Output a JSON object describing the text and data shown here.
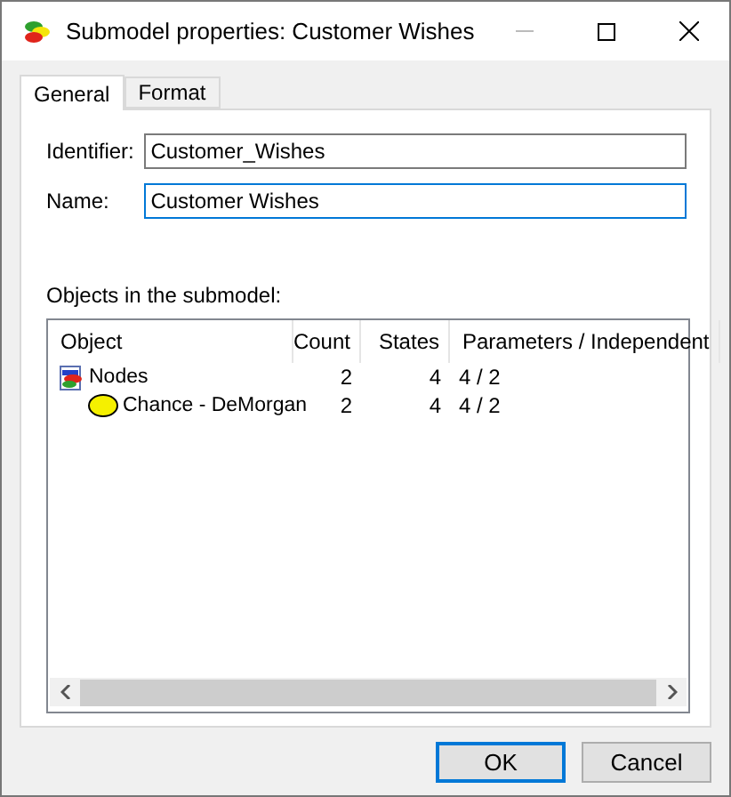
{
  "window": {
    "title": "Submodel properties: Customer Wishes"
  },
  "tabs": [
    {
      "label": "General",
      "selected": true
    },
    {
      "label": "Format",
      "selected": false
    }
  ],
  "fields": [
    {
      "label": "Identifier:",
      "value": "Customer_Wishes",
      "focused": false
    },
    {
      "label": "Name:",
      "value": "Customer Wishes",
      "focused": true
    }
  ],
  "objects": {
    "label": "Objects in the submodel:",
    "columns": [
      "Object",
      "Count",
      "States",
      "Parameters / Independent"
    ],
    "rows": [
      {
        "kind": "folder",
        "name": "Nodes",
        "count": "2",
        "states": "4",
        "parameters": "4 / 2",
        "children": [
          {
            "kind": "chance",
            "name": "Chance - DeMorgan",
            "count": "2",
            "states": "4",
            "parameters": "4 / 2"
          }
        ]
      }
    ]
  },
  "buttons": [
    {
      "label": "OK",
      "default": true
    },
    {
      "label": "Cancel",
      "default": false
    }
  ]
}
